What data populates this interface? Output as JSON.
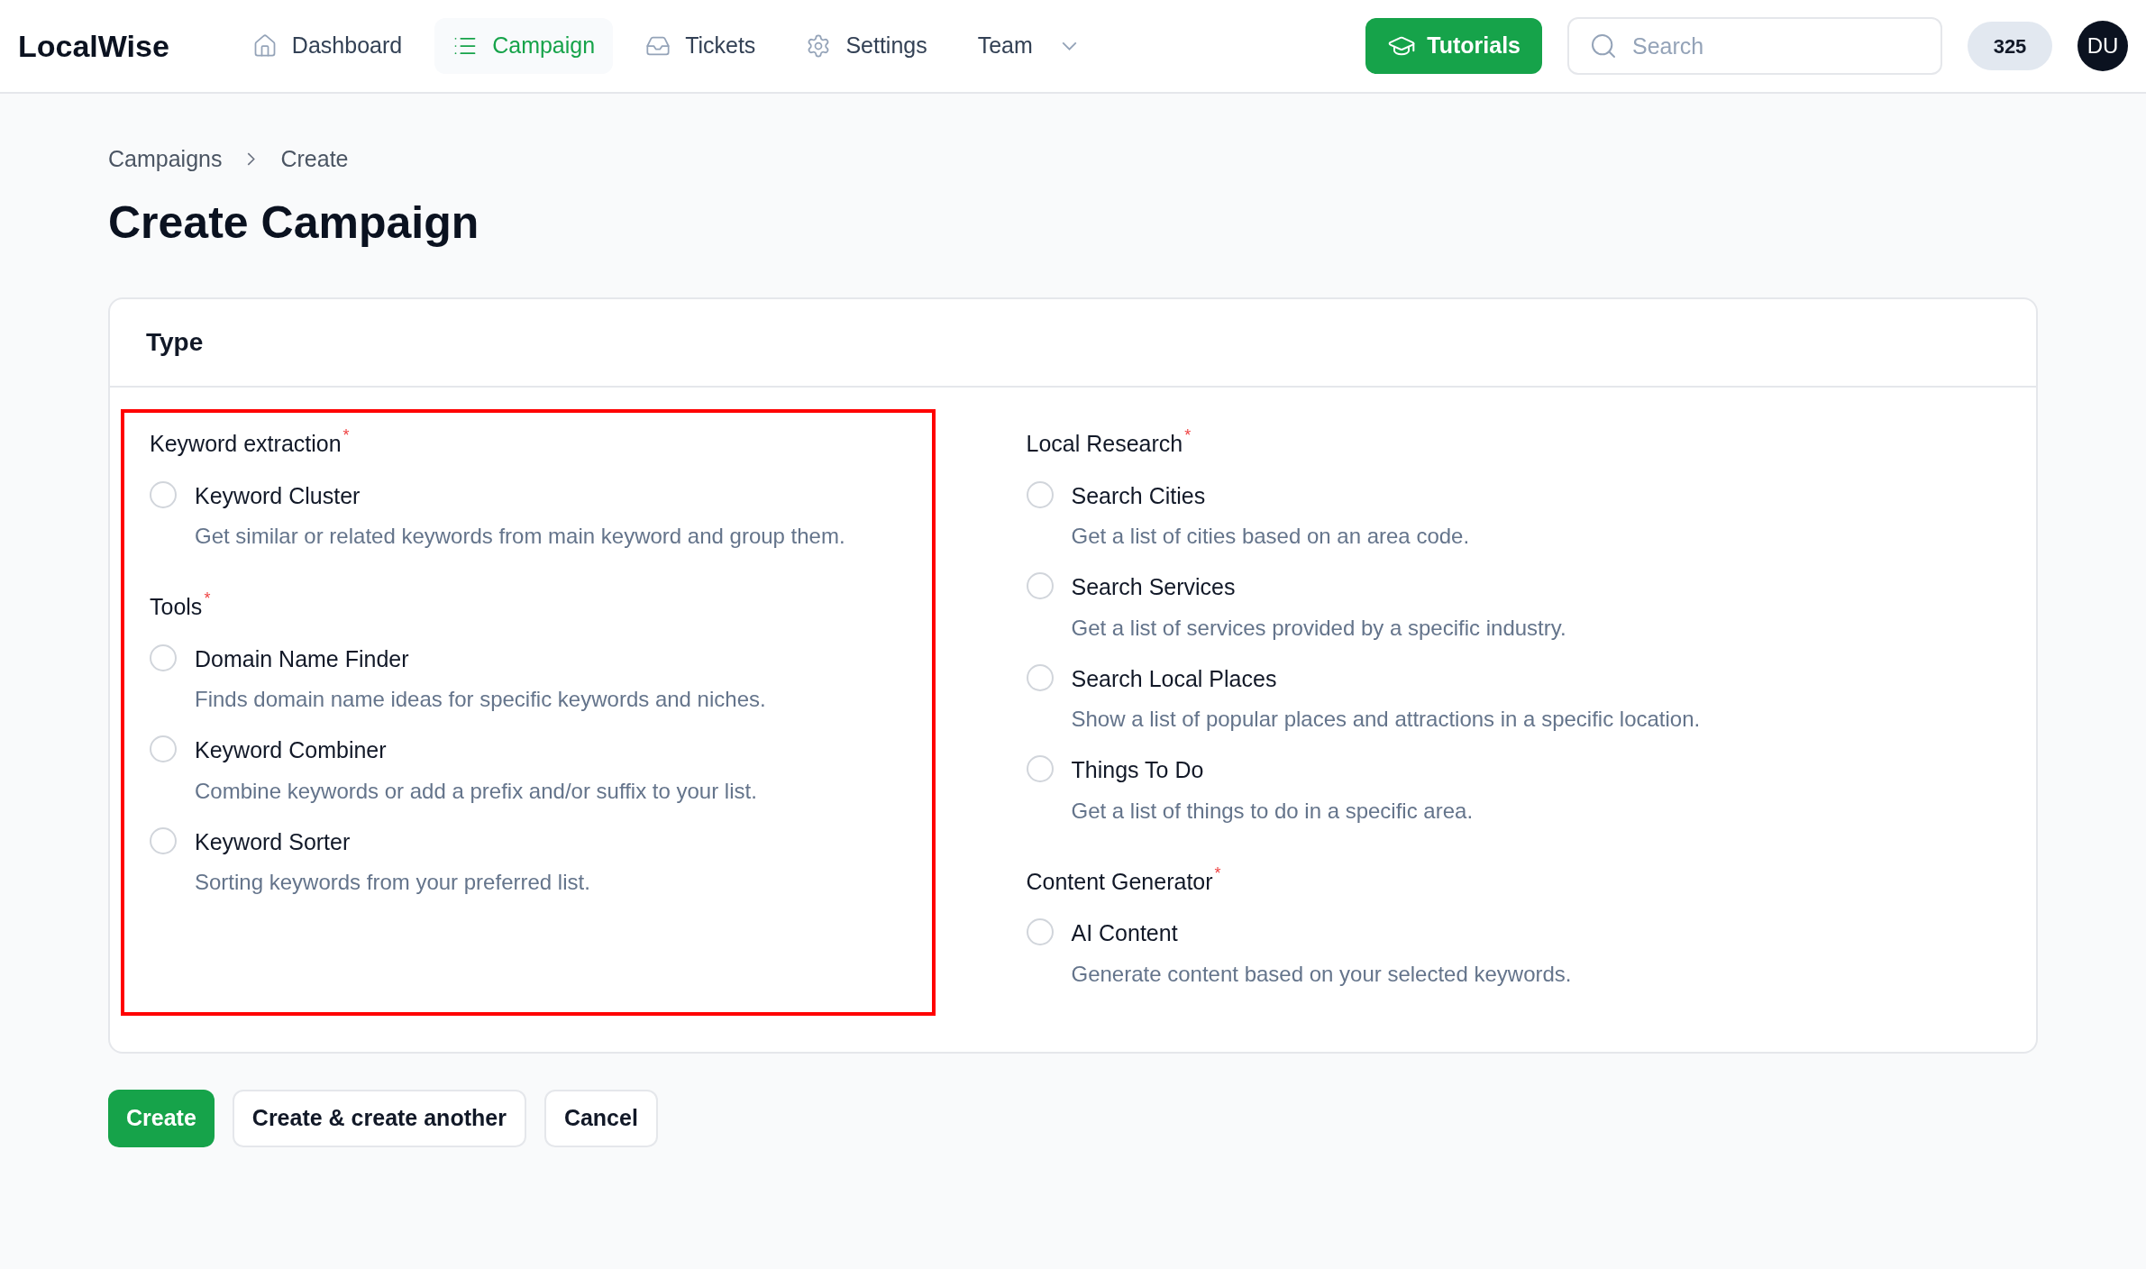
{
  "brand": "LocalWise",
  "nav": [
    {
      "label": "Dashboard",
      "selected": false,
      "has_menu": false
    },
    {
      "label": "Campaign",
      "selected": true,
      "has_menu": false
    },
    {
      "label": "Tickets",
      "selected": false,
      "has_menu": false
    },
    {
      "label": "Settings",
      "selected": false,
      "has_menu": false
    },
    {
      "label": "Team",
      "selected": false,
      "has_menu": true
    }
  ],
  "tutorials_button": "Tutorials",
  "search": {
    "placeholder": "Search"
  },
  "count_badge": "325",
  "avatar": "DU",
  "breadcrumbs": [
    "Campaigns",
    "Create"
  ],
  "page_title": "Create Campaign",
  "card": {
    "title": "Type",
    "columns": [
      {
        "highlighted": true,
        "groups": [
          {
            "title": "Keyword extraction",
            "marker": "*",
            "options": [
              {
                "label": "Keyword Cluster",
                "description": "Get similar or related keywords from main keyword and group them.",
                "selected": false
              }
            ]
          },
          {
            "title": "Tools",
            "marker": "*",
            "options": [
              {
                "label": "Domain Name Finder",
                "description": "Finds domain name ideas for specific keywords and niches.",
                "selected": false
              },
              {
                "label": "Keyword Combiner",
                "description": "Combine keywords or add a prefix and/or suffix to your list.",
                "selected": false
              },
              {
                "label": "Keyword Sorter",
                "description": "Sorting keywords from your preferred list.",
                "selected": false
              }
            ]
          }
        ]
      },
      {
        "highlighted": false,
        "groups": [
          {
            "title": "Local Research",
            "marker": "*",
            "options": [
              {
                "label": "Search Cities",
                "description": "Get a list of cities based on an area code.",
                "selected": false
              },
              {
                "label": "Search Services",
                "description": "Get a list of services provided by a specific industry.",
                "selected": false
              },
              {
                "label": "Search Local Places",
                "description": "Show a list of popular places and attractions in a specific location.",
                "selected": false
              },
              {
                "label": "Things To Do",
                "description": "Get a list of things to do in a specific area.",
                "selected": false
              }
            ]
          },
          {
            "title": "Content Generator",
            "marker": "*",
            "options": [
              {
                "label": "AI Content",
                "description": "Generate content based on your selected keywords.",
                "selected": false
              }
            ]
          }
        ]
      }
    ]
  },
  "actions": [
    {
      "label": "Create",
      "kind": "primary"
    },
    {
      "label": "Create & create another",
      "kind": "secondary"
    },
    {
      "label": "Cancel",
      "kind": "secondary"
    }
  ]
}
